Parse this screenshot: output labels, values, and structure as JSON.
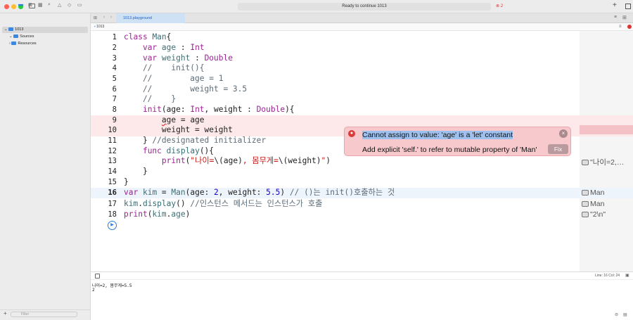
{
  "window": {
    "status": "Ready to continue 1013",
    "error_count": "2"
  },
  "sidebar": {
    "project": "1013",
    "items": [
      "Sources",
      "Resources"
    ],
    "filter": "Filter"
  },
  "tab": {
    "label": "1013.playground"
  },
  "jumpbar": {
    "path": "1013"
  },
  "editor": {
    "line_numbers": [
      "1",
      "2",
      "3",
      "4",
      "5",
      "6",
      "7",
      "8",
      "9",
      "10",
      "11",
      "12",
      "13",
      "14",
      "15",
      "16",
      "17",
      "18"
    ]
  },
  "error": {
    "title": "Cannot assign to value: 'age' is a 'let' constant",
    "fix_text": "Add explicit 'self.' to refer to mutable property of 'Man'",
    "fix_label": "Fix",
    "close": "×"
  },
  "results": {
    "r13": "\"나이=2,…",
    "r16": "Man",
    "r17": "Man",
    "r18": "\"2\\n\""
  },
  "console": {
    "line1": "나이=2, 몸무게=5.5",
    "line2": "2",
    "position": "Line: 16  Col: 24"
  },
  "colors": {
    "error_bg": "#f7c9cc",
    "error_line": "#fde9ea",
    "current_line": "#eef4fc",
    "accent": "#2b7de0"
  }
}
